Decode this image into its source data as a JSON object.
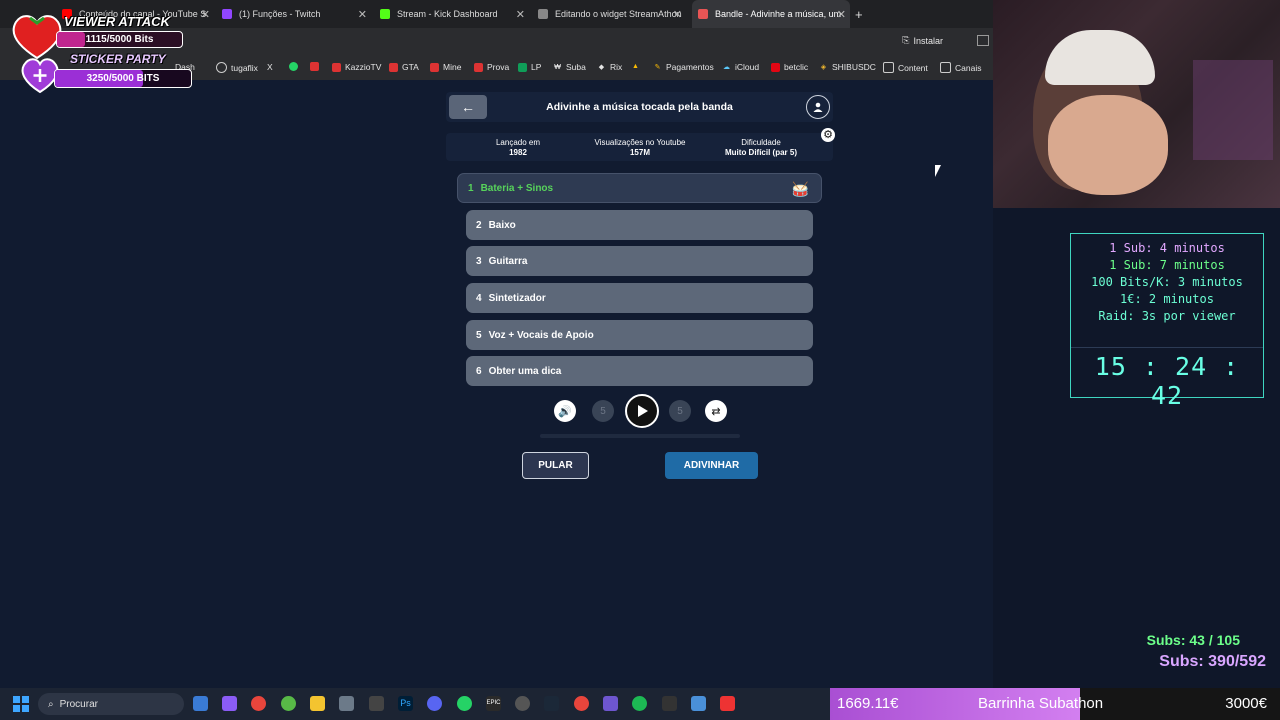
{
  "browser": {
    "tabs": [
      {
        "label": "Conteúdo do canal - YouTube S",
        "color": "#ff0000"
      },
      {
        "label": "(1) Funções - Twitch",
        "color": "#9146ff"
      },
      {
        "label": "Stream - Kick Dashboard",
        "color": "#53fc18"
      },
      {
        "label": "Editando o widget StreamAthon",
        "color": "#888888"
      },
      {
        "label": "Bandle - Adivinhe a música, um",
        "color": "#e85555"
      }
    ],
    "new_tab": "+",
    "install_label": "Instalar",
    "bookmarks": [
      "Dash",
      "tugaflix",
      "X",
      "",
      "KazzioTV",
      "GTA",
      "Mine",
      "Prova",
      "LP",
      "Suba",
      "Rix",
      "",
      "Pagamentos",
      "iCloud",
      "betclic",
      "SHIBUSDC",
      "Content",
      "Canais"
    ]
  },
  "game": {
    "title": "Adivinhe a música tocada pela banda",
    "info": [
      {
        "label": "Lançado em",
        "value": "1982"
      },
      {
        "label": "Visualizações no Youtube",
        "value": "157M"
      },
      {
        "label": "Dificuldade",
        "value": "Muito Difícil (par 5)"
      }
    ],
    "options": [
      {
        "num": "1",
        "label": "Bateria + Sinos"
      },
      {
        "num": "2",
        "label": "Baixo"
      },
      {
        "num": "3",
        "label": "Guitarra"
      },
      {
        "num": "4",
        "label": "Sintetizador"
      },
      {
        "num": "5",
        "label": "Voz + Vocais de Apoio"
      },
      {
        "num": "6",
        "label": "Obter uma dica"
      }
    ],
    "rewind_label": "5",
    "forward_label": "5",
    "skip_label": "PULAR",
    "guess_label": "ADIVINHAR"
  },
  "overlay": {
    "viewer_attack": "VIEWER ATTACK",
    "viewer_bits": "1115/5000 Bits",
    "sticker_party": "STICKER PARTY",
    "sticker_bits": "3250/5000 BITS",
    "viewer_progress": 0.223,
    "sticker_progress": 0.65,
    "timer_rules": [
      {
        "text": "1 Sub: 4 minutos",
        "color": "#e2a8ff"
      },
      {
        "text": "1 Sub: 7 minutos",
        "color": "#6cff8a"
      },
      {
        "text": "100 Bits/K: 3 minutos",
        "color": "#6cffd4"
      },
      {
        "text": "1€: 2 minutos",
        "color": "#6cffd4"
      },
      {
        "text": "Raid: 3s por viewer",
        "color": "#6cffd4"
      }
    ],
    "clock": "15 : 24 : 42",
    "subs_goal_1": "Subs: 43 / 105",
    "subs_goal_2": "Subs: 390/592",
    "bar_current": "1669.11€",
    "bar_label": "Barrinha Subathon",
    "bar_goal": "3000€",
    "bar_progress": 0.556
  },
  "taskbar": {
    "search_placeholder": "Procurar"
  }
}
